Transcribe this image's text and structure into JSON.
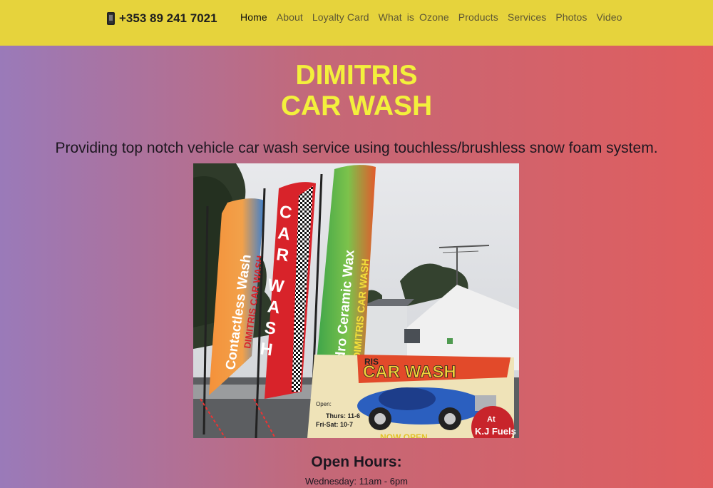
{
  "header": {
    "phone": "+353 89 241 7021",
    "nav": [
      "Home",
      "About",
      "Loyalty Card",
      "What is Ozone",
      "Products",
      "Services",
      "Photos",
      "Video"
    ]
  },
  "hero": {
    "title_line1": "DIMITRIS",
    "title_line2": "CAR WASH",
    "tagline": "Providing top notch vehicle car wash service using touchless/brushless snow foam system."
  },
  "photo": {
    "flag1": "Contactless Wash",
    "flag1_sub": "DIMITRIS CAR WASH",
    "flag2": "CAR WASH",
    "flag3": "Hydro Ceramic Wax",
    "flag3_sub": "DIMITRIS CAR WASH",
    "sign_title": "CAR WASH",
    "sign_name": "RIS",
    "sign_open": "Open:",
    "sign_days1": "Thurs: 11-6",
    "sign_days2": "Fri-Sat: 10-7",
    "sign_at": "At",
    "sign_loc": "K.J Fuels",
    "sign_bottom": "NOW OPEN"
  },
  "hours": {
    "title": "Open Hours:",
    "lines": [
      "Wednesday: 11am - 6pm"
    ]
  },
  "colors": {
    "header_bg": "#e6d33c",
    "title": "#f3f03c",
    "gradient_left": "#9a7ab9",
    "gradient_right": "#e05d5e"
  }
}
